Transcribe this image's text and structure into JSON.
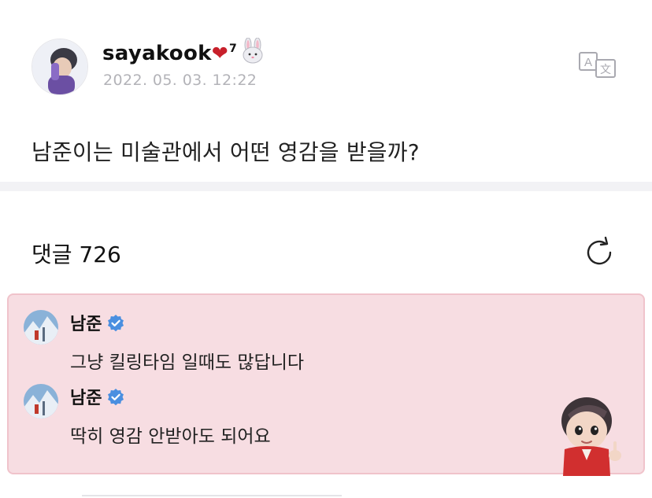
{
  "post": {
    "author": {
      "name": "sayakook",
      "heart_emoji": "❤",
      "superscript": "7",
      "bunny_icon": "rabbit-face-icon"
    },
    "timestamp": "2022. 05. 03. 12:22",
    "body": "남준이는 미술관에서 어떤 영감을 받을까?",
    "translate_icon": "translate-icon"
  },
  "comments_section": {
    "title": "댓글 726",
    "refresh_icon": "refresh-icon",
    "items": [
      {
        "author": "남준",
        "verified": true,
        "text": "그냥 킬링타임 일때도 많답니다"
      },
      {
        "author": "남준",
        "verified": true,
        "text": "딱히 영감 안받아도 되어요"
      }
    ]
  },
  "colors": {
    "accent_verified": "#4a8fe0",
    "comment_panel_bg": "#f7dde2",
    "comment_panel_border": "#f0c3cb",
    "timestamp": "#b3b3b8"
  }
}
